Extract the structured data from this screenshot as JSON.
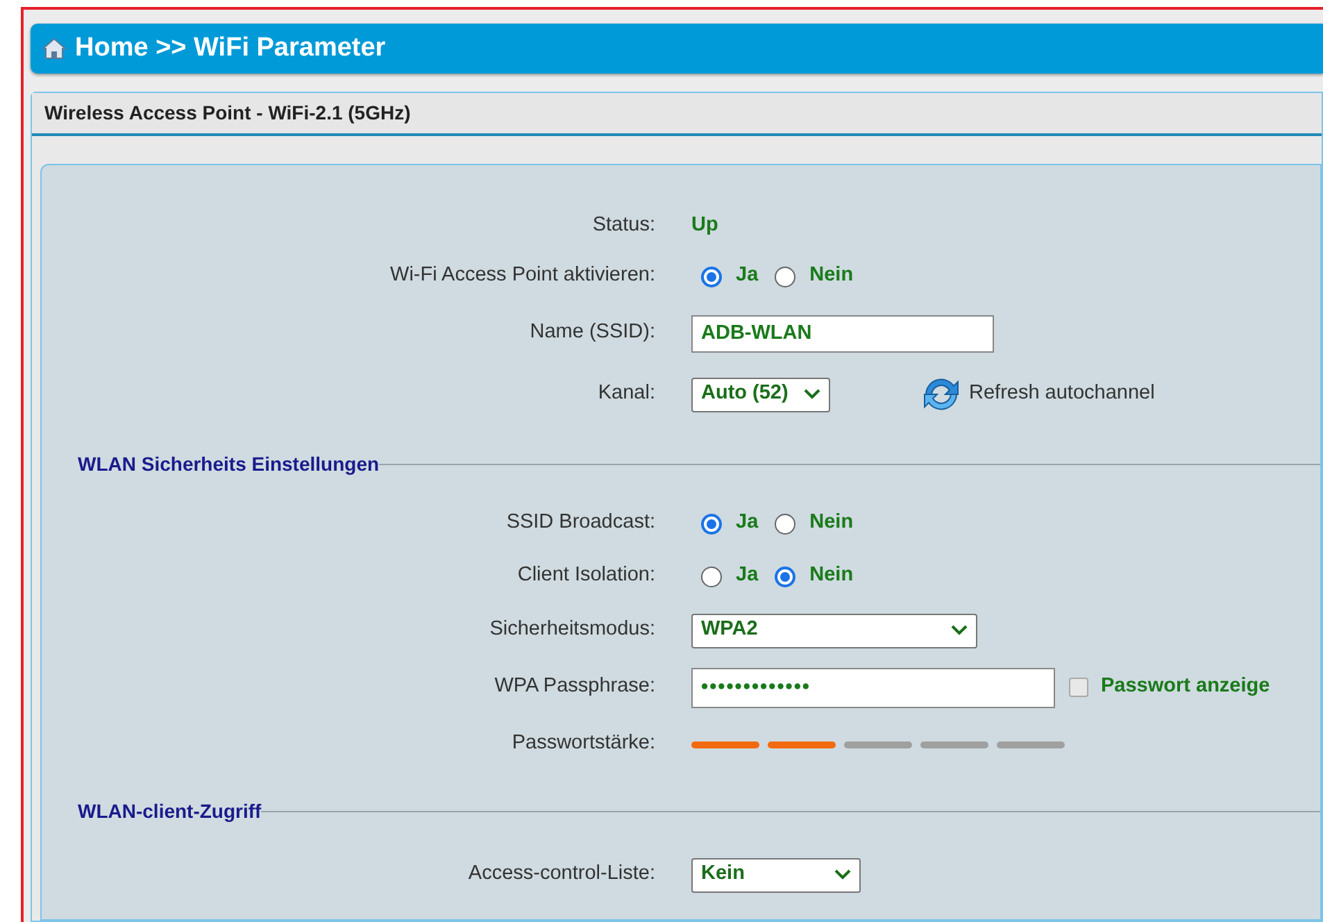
{
  "header": {
    "title": "Home >> WiFi Parameter"
  },
  "panel": {
    "title": "Wireless Access Point - WiFi-2.1 (5GHz)"
  },
  "sections": [
    {
      "rows": [
        {
          "kind": "status",
          "label": "Status:",
          "value": "Up"
        },
        {
          "kind": "radio",
          "label": "Wi-Fi Access Point aktivieren:",
          "options": [
            {
              "label": "Ja",
              "selected": true
            },
            {
              "label": "Nein",
              "selected": false
            }
          ]
        },
        {
          "kind": "input",
          "label": "Name (SSID):",
          "value": "ADB-WLAN"
        },
        {
          "kind": "select",
          "label": "Kanal:",
          "value": "Auto (52)",
          "action": {
            "label": "Refresh autochannel"
          }
        }
      ]
    },
    {
      "title": "WLAN Sicherheits Einstellungen",
      "rows": [
        {
          "kind": "radio",
          "label": "SSID Broadcast:",
          "options": [
            {
              "label": "Ja",
              "selected": true
            },
            {
              "label": "Nein",
              "selected": false
            }
          ]
        },
        {
          "kind": "radio",
          "label": "Client Isolation:",
          "options": [
            {
              "label": "Ja",
              "selected": false
            },
            {
              "label": "Nein",
              "selected": true
            }
          ]
        },
        {
          "kind": "select",
          "label": "Sicherheitsmodus:",
          "value": "WPA2"
        },
        {
          "kind": "password",
          "label": "WPA Passphrase:",
          "value": "•••••••••••••",
          "checkbox": {
            "label": "Passwort anzeige",
            "checked": false
          }
        },
        {
          "kind": "strength",
          "label": "Passwortstärke:",
          "segments": [
            {
              "on": true
            },
            {
              "on": true
            },
            {
              "on": false
            },
            {
              "on": false
            },
            {
              "on": false
            }
          ]
        }
      ]
    },
    {
      "title": "WLAN-client-Zugriff",
      "rows": [
        {
          "kind": "select",
          "label": "Access-control-Liste:",
          "value": "Kein"
        }
      ]
    }
  ]
}
